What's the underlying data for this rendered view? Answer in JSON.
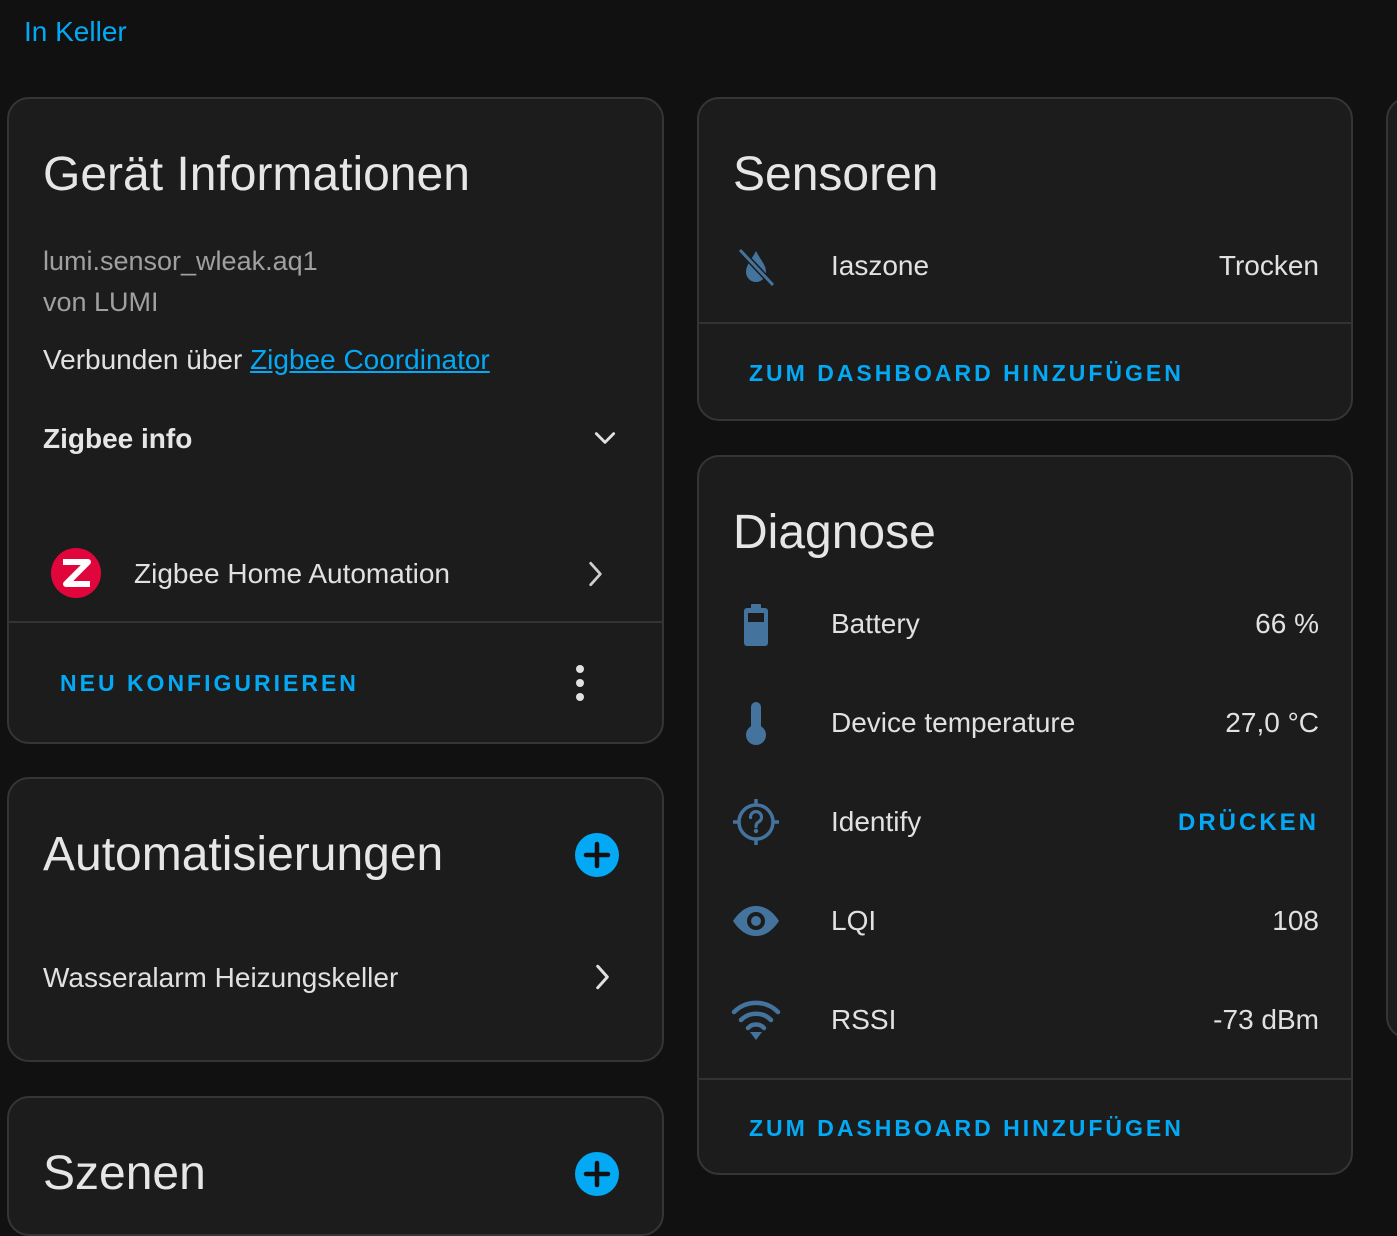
{
  "area": {
    "link": "In Keller"
  },
  "device_info": {
    "title": "Gerät Informationen",
    "model": "lumi.sensor_wleak.aq1",
    "manufacturer": "von LUMI",
    "connected_prefix": "Verbunden über",
    "connected_link": "Zigbee Coordinator",
    "zigbee_info_label": "Zigbee info",
    "integration_label": "Zigbee Home Automation",
    "reconfigure_label": "NEU KONFIGURIEREN"
  },
  "automations": {
    "title": "Automatisierungen",
    "items": [
      {
        "label": "Wasseralarm Heizungskeller"
      }
    ]
  },
  "scenes": {
    "title": "Szenen"
  },
  "sensors": {
    "title": "Sensoren",
    "rows": [
      {
        "icon": "water-off-icon",
        "label": "Iaszone",
        "value": "Trocken"
      }
    ],
    "add_to_dashboard": "ZUM DASHBOARD HINZUFÜGEN"
  },
  "diagnostics": {
    "title": "Diagnose",
    "rows": [
      {
        "icon": "battery-icon",
        "label": "Battery",
        "value": "66 %"
      },
      {
        "icon": "thermometer-icon",
        "label": "Device temperature",
        "value": "27,0 °C"
      },
      {
        "icon": "crosshairs-question-icon",
        "label": "Identify",
        "value": "DRÜCKEN"
      },
      {
        "icon": "eye-icon",
        "label": "LQI",
        "value": "108"
      },
      {
        "icon": "wifi-icon",
        "label": "RSSI",
        "value": "-73 dBm"
      }
    ],
    "add_to_dashboard": "ZUM DASHBOARD HINZUFÜGEN"
  },
  "colors": {
    "accent": "#03a9f4",
    "icon": "#44739e",
    "card_bg": "#1c1c1c",
    "page_bg": "#111111",
    "zigbee_logo": "#e0053a"
  }
}
